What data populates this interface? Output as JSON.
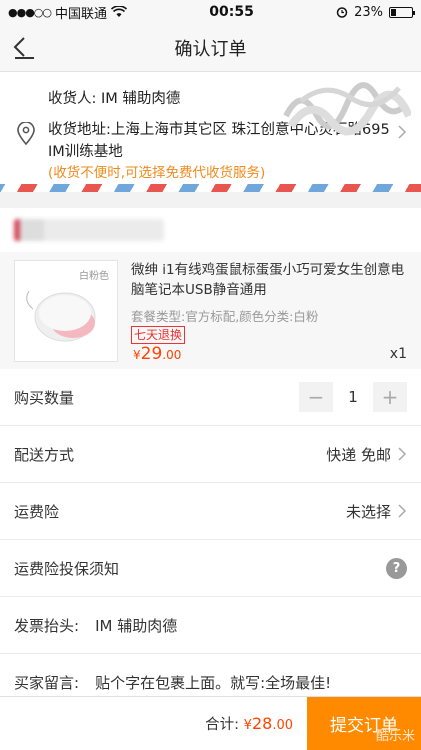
{
  "status_bar": {
    "carrier": "中国联通",
    "time": "00:55",
    "battery": "23%"
  },
  "nav": {
    "title": "确认订单"
  },
  "address": {
    "recipient_label": "收货人:",
    "recipient": "IM 辅助肉德",
    "address_label": "收货地址:",
    "address": "上海上海市其它区 珠江创意中心灵石路695 IM训练基地",
    "tip": "(收货不便时,可选择免费代收货服务)"
  },
  "item": {
    "thumb_tag": "白粉色",
    "name": "微绅 i1有线鸡蛋鼠标蛋蛋小巧可爱女生创意电脑笔记本USB静音通用",
    "spec": "套餐类型:官方标配,颜色分类:白粉",
    "badge": "七天退换",
    "price_symbol": "¥",
    "price_int": "29",
    "price_dec": ".00",
    "quantity": "x1"
  },
  "rows": {
    "qty_label": "购买数量",
    "qty_value": "1",
    "shipping_label": "配送方式",
    "shipping_value": "快递 免邮",
    "insurance_label": "运费险",
    "insurance_value": "未选择",
    "notice_label": "运费险投保须知",
    "invoice_label": "发票抬头:",
    "invoice_value": "IM 辅助肉德",
    "message_label": "买家留言:",
    "message_value": "贴个字在包裹上面。就写:全场最佳!"
  },
  "footer": {
    "total_label": "合计:",
    "total_symbol": "¥",
    "total_int": "28",
    "total_dec": ".00",
    "submit": "提交订单",
    "watermark": "酷乐米"
  },
  "colors": {
    "accent": "#ff8a00",
    "price": "#ff4400",
    "tip": "#f08a1c"
  }
}
